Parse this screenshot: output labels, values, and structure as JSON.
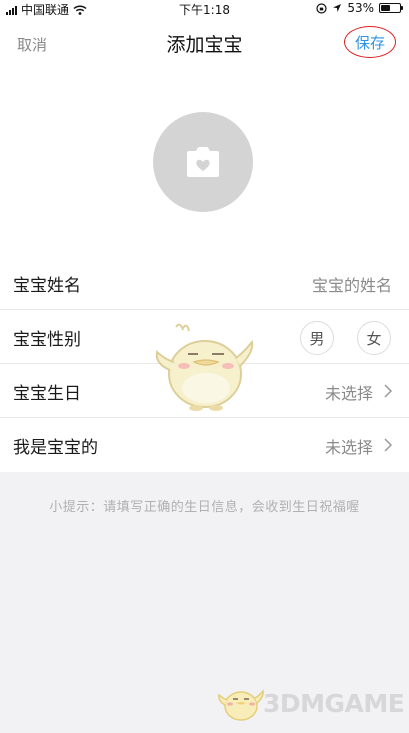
{
  "status_bar": {
    "carrier": "中国联通",
    "time": "下午1:18",
    "battery_percent": "53%",
    "battery_level": 0.53
  },
  "nav": {
    "cancel": "取消",
    "title": "添加宝宝",
    "save": "保存"
  },
  "avatar": {
    "icon": "camera-icon"
  },
  "form": {
    "name_label": "宝宝姓名",
    "name_placeholder": "宝宝的姓名",
    "gender_label": "宝宝性别",
    "gender_male": "男",
    "gender_female": "女",
    "birthday_label": "宝宝生日",
    "birthday_value": "未选择",
    "relation_label": "我是宝宝的",
    "relation_value": "未选择"
  },
  "tip": "小提示：请填写正确的生日信息，会收到生日祝福喔",
  "watermark": "3DMGAME",
  "colors": {
    "accent": "#2f93e6",
    "highlight_circle": "#e02020",
    "avatar_bg": "#d4d4d4",
    "page_bg": "#f2f2f4"
  }
}
